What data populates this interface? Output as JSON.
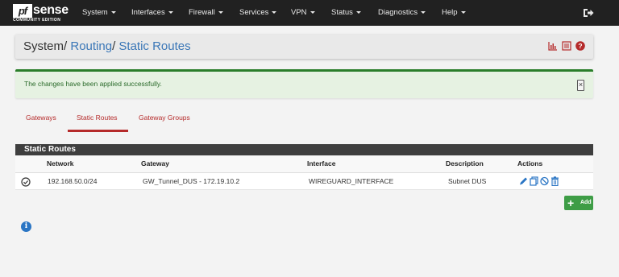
{
  "brand": {
    "name": "sense",
    "box": "pf",
    "edition": "COMMUNITY EDITION"
  },
  "nav": [
    {
      "label": "System"
    },
    {
      "label": "Interfaces"
    },
    {
      "label": "Firewall"
    },
    {
      "label": "Services"
    },
    {
      "label": "VPN"
    },
    {
      "label": "Status"
    },
    {
      "label": "Diagnostics"
    },
    {
      "label": "Help"
    }
  ],
  "breadcrumb": {
    "root": "System",
    "sep1": "/",
    "section": "Routing",
    "sep2": "/",
    "page": "Static Routes"
  },
  "header_icons": [
    "chart-icon",
    "list-icon",
    "help-icon"
  ],
  "alert": {
    "text": "The changes have been applied successfully.",
    "close": "×"
  },
  "tabs": [
    {
      "label": "Gateways",
      "active": false
    },
    {
      "label": "Static Routes",
      "active": true
    },
    {
      "label": "Gateway Groups",
      "active": false
    }
  ],
  "table": {
    "title": "Static Routes",
    "columns": [
      "Network",
      "Gateway",
      "Interface",
      "Description",
      "Actions"
    ],
    "rows": [
      {
        "network": "192.168.50.0/24",
        "gateway": "GW_Tunnel_DUS - 172.19.10.2",
        "interface": "WIREGUARD_INTERFACE",
        "description": "Subnet DUS",
        "actions": [
          "edit-icon",
          "copy-icon",
          "disable-icon",
          "delete-icon"
        ]
      }
    ]
  },
  "add_button": {
    "label": "Add"
  },
  "colors": {
    "navbar": "#212121",
    "link": "#3b77b7",
    "tab": "#b52a2a",
    "success": "#2a7e2a",
    "add": "#3e9d46",
    "panel_head": "#3e3e3e"
  }
}
